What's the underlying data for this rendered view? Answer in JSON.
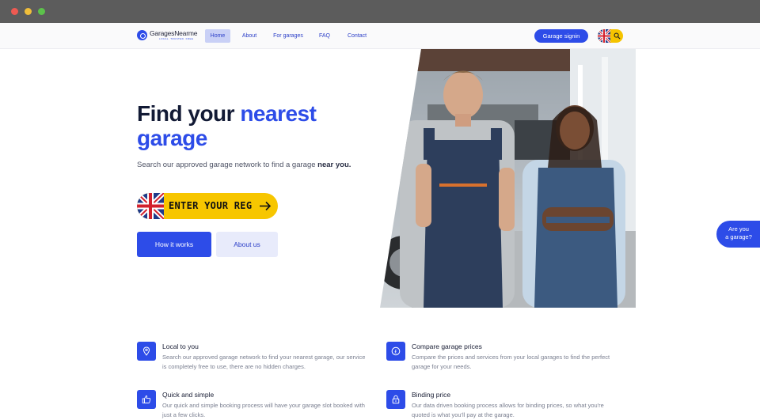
{
  "nav": {
    "logo_name": "GaragesNearme",
    "logo_sub": "LOCAL. TRUSTED. FREE",
    "links": [
      "Home",
      "About",
      "For garages",
      "FAQ",
      "Contact"
    ],
    "signin_label": "Garage signin"
  },
  "hero": {
    "title_line1_plain": "Find your ",
    "title_line1_accent": "nearest",
    "title_line2_accent": "garage",
    "subtitle_plain": "Search our approved garage network to find a garage ",
    "subtitle_bold": "near you.",
    "reg_placeholder": "ENTER YOUR REG",
    "btn_how": "How it works",
    "btn_about": "About us"
  },
  "tab": {
    "line1": "Are you",
    "line2": "a garage?"
  },
  "features": [
    {
      "title": "Local to you",
      "desc": "Search our approved garage network to find your nearest garage, our service is completely free to use, there are no hidden charges.",
      "icon": "location-pin-icon"
    },
    {
      "title": "Compare garage prices",
      "desc": "Compare the prices and services from your local garages to find the perfect garage for your needs.",
      "icon": "currency-icon"
    },
    {
      "title": "Quick and simple",
      "desc": "Our quick and simple booking process will have your garage slot booked with just a few clicks.",
      "icon": "thumbs-up-icon"
    },
    {
      "title": "Binding price",
      "desc": "Our data driven booking process allows for binding prices, so what you're quoted is what you'll pay at the garage.",
      "icon": "lock-icon"
    }
  ],
  "colors": {
    "accent": "#2d4ce8",
    "reg_yellow": "#f7c600",
    "heading": "#121a35"
  }
}
